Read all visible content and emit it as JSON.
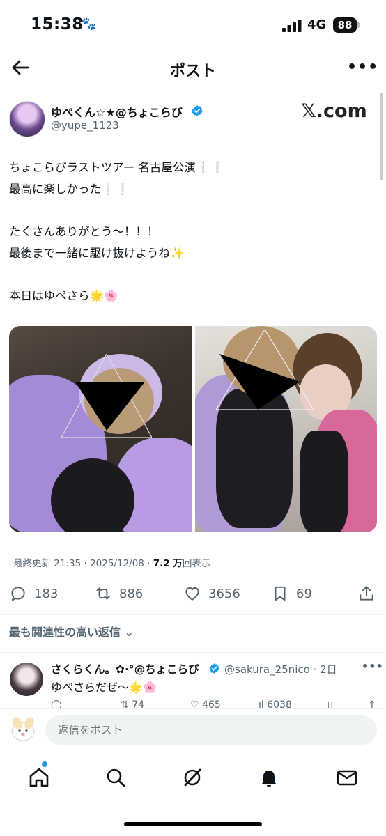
{
  "status_bar": {
    "time": "15:38",
    "time_icon": "paw-icon",
    "network": "4G",
    "battery": "88"
  },
  "header": {
    "title": "ポスト"
  },
  "post": {
    "author_name": "ゆぺくん☆★@ちょこらび",
    "handle": "@yupe_1123",
    "watermark": "𝕏.com",
    "lines": [
      "ちょこらびラストツアー 名古屋公演",
      "最高に楽しかった",
      "たくさんありがとう〜！！！",
      "最後まで一緒に駆け抜けようね",
      "本日はゆぺさら"
    ],
    "emoji": {
      "exclaim": "❕",
      "sparkles": "✨",
      "glow_star": "🌟",
      "blossom": "🌸"
    },
    "meta_prefix": "最終更新 21:35 · 2025/12/08 · ",
    "views_count": "7.2 万",
    "views_label": "回表示",
    "replies": "183",
    "reposts": "886",
    "likes": "3656",
    "bookmarks": "69"
  },
  "relevance_label": "最も関連性の高い返信",
  "reply": {
    "name": "さくらくん。✿·°@ちょこらび",
    "handle_time": "@sakura_25nico · 2日",
    "text": "ゆぺさらだぜ〜",
    "actions_partial": {
      "reposts": "74",
      "likes": "465",
      "views": "6038"
    }
  },
  "composer": {
    "placeholder": "返信をポスト"
  },
  "colors": {
    "accent": "#1d9bf0",
    "text": "#0f1419",
    "secondary": "#536471",
    "divider": "#eff3f4"
  }
}
